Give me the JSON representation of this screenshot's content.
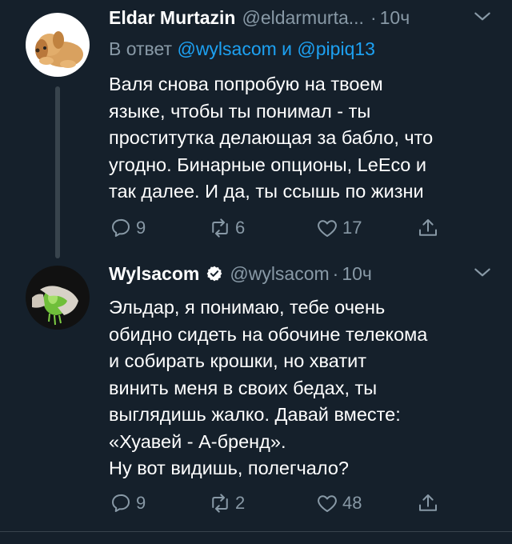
{
  "tweets": [
    {
      "name": "Eldar Murtazin",
      "handle": "@eldarmurta...",
      "dot": "·",
      "time": "10ч",
      "reply_prefix": "В ответ",
      "reply_mention_1": "@wylsacom",
      "reply_and": "и",
      "reply_mention_2": "@pipiq13",
      "text": "Валя снова попробую на твоем\nязыке, чтобы ты понимал - ты\nпроститутка делающая за бабло, что\nугодно. Бинарные опционы, LeEco и\nтак далее. И да, ты ссышь по жизни",
      "replies": "9",
      "retweets": "6",
      "likes": "17",
      "avatar_icon": "plush-dog-avatar"
    },
    {
      "name": "Wylsacom",
      "handle": "@wylsacom",
      "dot": "·",
      "time": "10ч",
      "verified": true,
      "text": "Эльдар, я понимаю, тебе очень\nобидно сидеть на обочине телекома\nи собирать крошки, но хватит\nвинить меня в своих бедах, ты\nвыглядишь жалко. Давай вместе:\n«Хуавей - А-бренд».\nНу вот видишь, полегчало?",
      "replies": "9",
      "retweets": "2",
      "likes": "48",
      "avatar_icon": "hand-squeezing-lime-avatar"
    }
  ],
  "colors": {
    "background": "#15202b",
    "text": "#ffffff",
    "secondary": "#8899a6",
    "accent": "#1da1f2",
    "verified": "#ffffff"
  }
}
